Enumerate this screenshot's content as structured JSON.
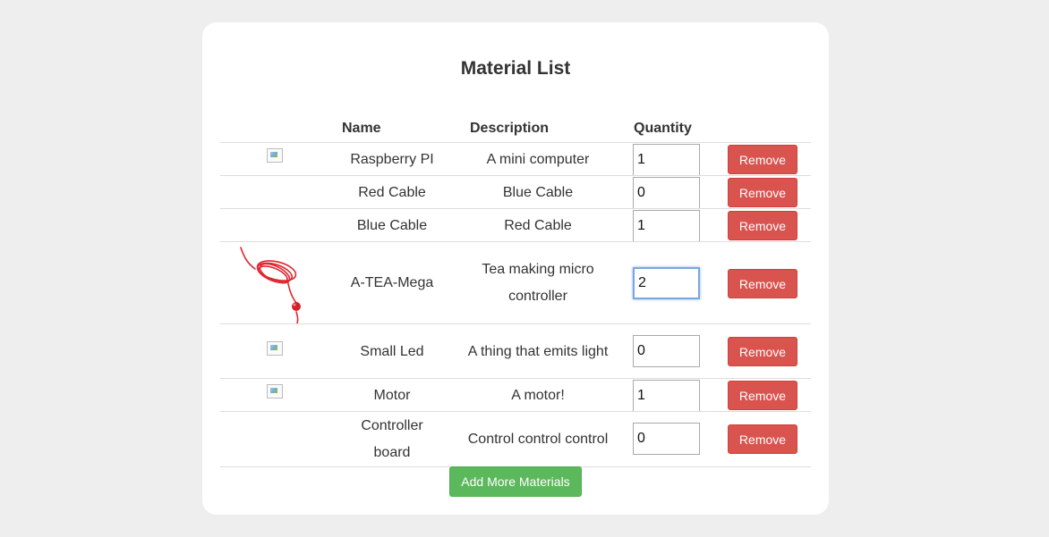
{
  "page": {
    "title": "Material List"
  },
  "table": {
    "headers": {
      "name": "Name",
      "description": "Description",
      "quantity": "Quantity"
    },
    "rows": [
      {
        "image": "broken-image",
        "name": "Raspberry PI",
        "description": "A mini computer",
        "quantity": "1",
        "remove_label": "Remove"
      },
      {
        "image": "none",
        "name": "Red Cable",
        "description": "Blue Cable",
        "quantity": "0",
        "remove_label": "Remove"
      },
      {
        "image": "none",
        "name": "Blue Cable",
        "description": "Red Cable",
        "quantity": "1",
        "remove_label": "Remove"
      },
      {
        "image": "red-cable-photo",
        "name": "A-TEA-Mega",
        "description": "Tea making micro controller",
        "quantity": "2",
        "remove_label": "Remove"
      },
      {
        "image": "broken-image",
        "name": "Small Led",
        "description": "A thing that emits light",
        "quantity": "0",
        "remove_label": "Remove"
      },
      {
        "image": "broken-image",
        "name": "Motor",
        "description": "A motor!",
        "quantity": "1",
        "remove_label": "Remove"
      },
      {
        "image": "none",
        "name": "Controller board",
        "description": "Control control control",
        "quantity": "0",
        "remove_label": "Remove"
      }
    ]
  },
  "actions": {
    "add_more_label": "Add More Materials"
  },
  "colors": {
    "remove": "#d9534f",
    "add": "#5cb85c",
    "background": "#eeeeee",
    "card": "#ffffff"
  }
}
